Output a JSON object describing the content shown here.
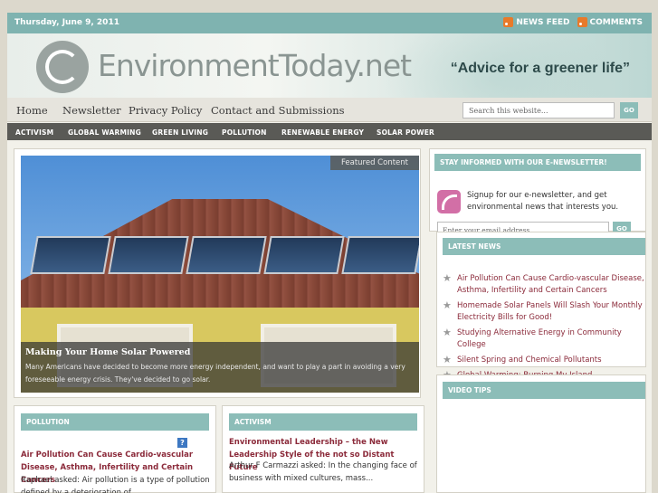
{
  "topbar": {
    "date": "Thursday, June 9, 2011",
    "news_feed": "NEWS FEED",
    "comments": "COMMENTS"
  },
  "header": {
    "logo_text": "EnvironmentToday.net",
    "tagline": "“Advice for a greener life”"
  },
  "nav": {
    "items": [
      "Home",
      "Newsletter",
      "Privacy Policy",
      "Contact and Submissions"
    ],
    "search_placeholder": "Search this website...",
    "go_label": "GO"
  },
  "categories": [
    "ACTIVISM",
    "GLOBAL WARMING",
    "GREEN LIVING",
    "POLLUTION",
    "RENEWABLE ENERGY",
    "SOLAR POWER"
  ],
  "featured": {
    "badge": "Featured Content",
    "title": "Making Your Home Solar Powered",
    "text": "Many Americans have decided to become more energy independent, and want to play a part in avoiding a very foreseeable energy crisis. They've decided to go solar."
  },
  "sidebar": {
    "enews_title": "STAY INFORMED WITH OUR E-NEWSLETTER!",
    "enews_text": "Signup for our e-newsletter, and get environmental news that interests you.",
    "email_placeholder": "Enter your email address...",
    "go_label": "GO",
    "latest_title": "LATEST NEWS",
    "latest_items": [
      "Air Pollution Can Cause Cardio-vascular Disease, Asthma, Infertility and Certain Cancers",
      "Homemade Solar Panels Will Slash Your Monthly Electricity Bills for Good!",
      "Studying Alternative Energy in Community College",
      "Silent Spring and Chemical Pollutants",
      "Global Warming: Burning My Island"
    ],
    "video_title": "VIDEO TIPS"
  },
  "pollution_box": {
    "title": "POLLUTION",
    "headline": "Air Pollution Can Cause Cardio-vascular Disease, Asthma, Infertility and Certain Cancers",
    "text": "Raphael asked: Air pollution is a type of pollution defined by a deterioration of..."
  },
  "activism_box": {
    "title": "ACTIVISM",
    "headline": "Environmental Leadership – the New Leadership Style of the not so Distant Future",
    "text": "Arthur F Carmazzi asked: In the changing face of business with mixed cultures, mass..."
  }
}
